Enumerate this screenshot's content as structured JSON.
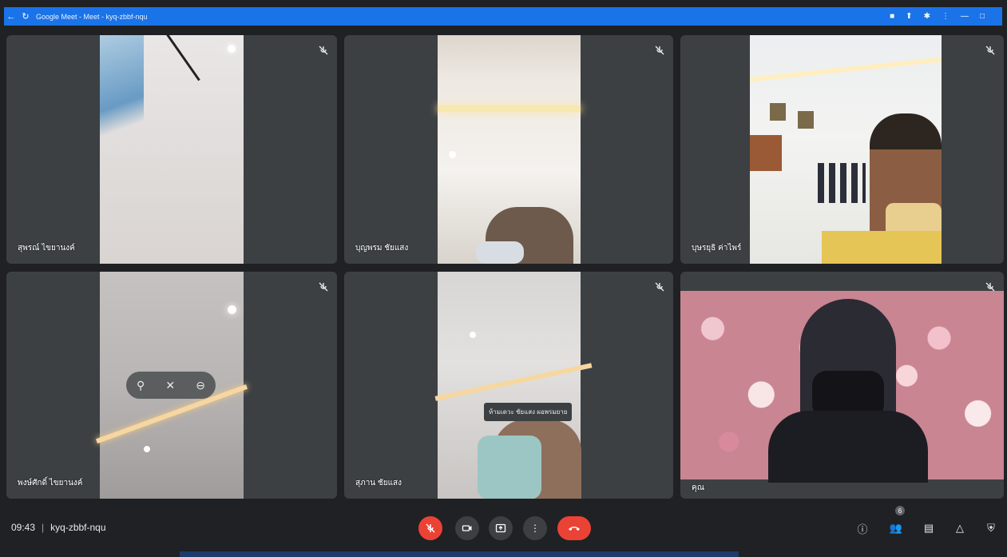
{
  "window": {
    "title": "Google Meet - Meet - kyq-zbbf-nqu"
  },
  "participants": [
    {
      "name": "สุพรณ์ ไขยานงค์"
    },
    {
      "name": "บุญพรม ชัยแสง"
    },
    {
      "name": "บุษรยุธิ ค่าไพร์"
    },
    {
      "name": "พงษ์ศักดิ์ ไขยานงค์"
    },
    {
      "name": "สุภาน ชัยแสง"
    },
    {
      "name": "คุณ"
    }
  ],
  "tooltip": {
    "text": "ห้ามเดวะ ชัยแสง ผอพรมยาย"
  },
  "footer": {
    "time": "09:43",
    "separator": "|",
    "meeting_code": "kyq-zbbf-nqu",
    "participant_count": "6"
  },
  "colors": {
    "accent": "#1a73e8",
    "danger": "#ea4335",
    "tile_bg": "#3c4043",
    "page_bg": "#202124"
  },
  "icons": {
    "mic_muted": "mic-off-icon",
    "camera": "camera-icon",
    "present": "present-screen-icon",
    "more": "more-options-icon",
    "hangup": "hangup-icon",
    "info": "info-icon",
    "people": "people-icon",
    "chat": "chat-icon",
    "activities": "activities-icon",
    "host": "host-controls-icon"
  }
}
